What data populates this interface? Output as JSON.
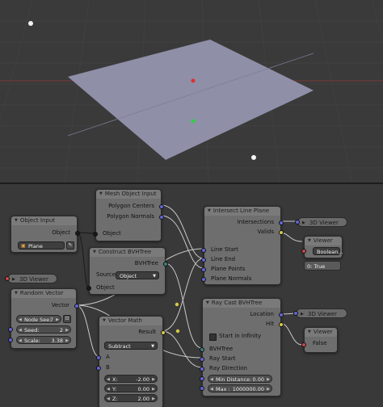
{
  "nodes": {
    "object_input": {
      "title": "Object Input",
      "output": "Object",
      "selected_object": "Plane"
    },
    "mesh_object_input": {
      "title": "Mesh Object Input",
      "outputs": [
        "Polygon Centers",
        "Polygon Normals"
      ],
      "input": "Object"
    },
    "construct_bvhtree": {
      "title": "Construct BVHTree",
      "output": "BVHTree",
      "source_label": "Source:",
      "source_value": "Object",
      "input": "Object"
    },
    "viewer_3d_left": {
      "title": "3D Viewer"
    },
    "random_vector": {
      "title": "Random Vector",
      "output": "Vector",
      "node_seed_label": "Node See:",
      "node_seed_value": "7",
      "seed_label": "Seed:",
      "seed_value": "2",
      "scale_label": "Scale:",
      "scale_value": "3.38"
    },
    "vector_math": {
      "title": "Vector Math",
      "output": "Result",
      "operation": "Subtract",
      "input_a": "A",
      "input_b": "B",
      "x_label": "X:",
      "x_value": "-2.00",
      "y_label": "Y:",
      "y_value": "0.00",
      "z_label": "Z:",
      "z_value": "2.00"
    },
    "intersect_line_plane": {
      "title": "Intersect Line Plane",
      "outputs": [
        "Intersections",
        "Valids"
      ],
      "inputs": [
        "Line Start",
        "Line End",
        "Plane Points",
        "Plane Normals"
      ]
    },
    "viewer_3d_top": {
      "title": "3D Viewer"
    },
    "viewer_boolean": {
      "title": "Viewer",
      "type_label": "Boolean...",
      "value": "0:  True"
    },
    "ray_cast_bvhtree": {
      "title": "Ray Cast BVHTree",
      "outputs": [
        "Location",
        "Hit"
      ],
      "start_in_infinity": "Start in Infinity",
      "inputs": [
        "BVHTree",
        "Ray Start",
        "Ray Direction"
      ],
      "min_distance_label": "Min Distance:",
      "min_distance_value": "0.00",
      "max_label": "Max :",
      "max_value": "1000000.00"
    },
    "viewer_3d_bottom": {
      "title": "3D Viewer"
    },
    "viewer_false": {
      "title": "Viewer",
      "value": "False"
    }
  },
  "colors": {
    "viewport_bg": "#3a3a3a",
    "plane": "#8f8fa8",
    "editor_bg": "#393939",
    "socket_vector": "#6464d6",
    "socket_bvh": "#3c7c7c",
    "socket_object": "#1a1a1a",
    "socket_bool": "#c84848",
    "socket_generic": "#d8c848"
  }
}
